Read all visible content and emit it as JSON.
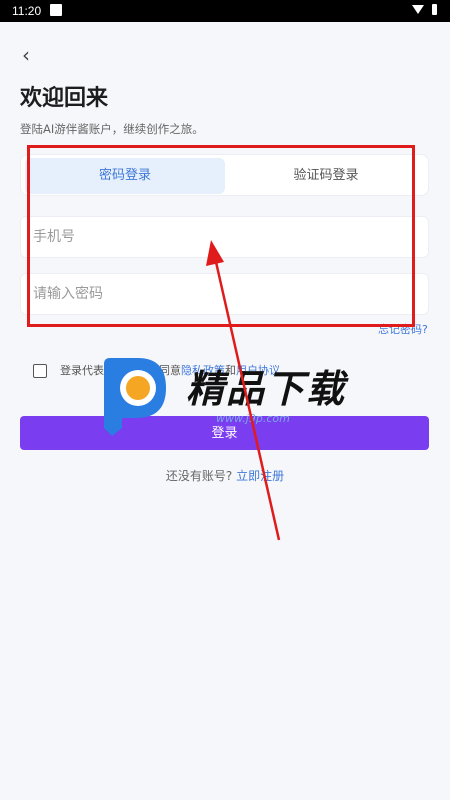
{
  "status_bar": {
    "time": "11:20"
  },
  "header": {
    "back_icon": "chevron-left-icon",
    "back_glyph": "‹",
    "title": "欢迎回来",
    "subtitle": "登陆AI游伴酱账户，继续创作之旅。"
  },
  "tabs": [
    {
      "label": "密码登录",
      "active": true
    },
    {
      "label": "验证码登录",
      "active": false
    }
  ],
  "form": {
    "phone_placeholder": "手机号",
    "password_placeholder": "请输入密码",
    "forgot_label": "忘记密码?"
  },
  "agreement": {
    "prefix": "登录代表我已阅读并同意",
    "privacy_link": "隐私政策",
    "conjunction": "和",
    "terms_link": "用户协议"
  },
  "login_button": {
    "label": "登录"
  },
  "signup": {
    "prompt": "还没有账号?",
    "link": "立即注册"
  },
  "watermark": {
    "text": "精品下载",
    "url": "www.j9p.com"
  },
  "colors": {
    "accent": "#7b3df0",
    "link": "#3f78d8",
    "annotation": "#e01b1b"
  }
}
